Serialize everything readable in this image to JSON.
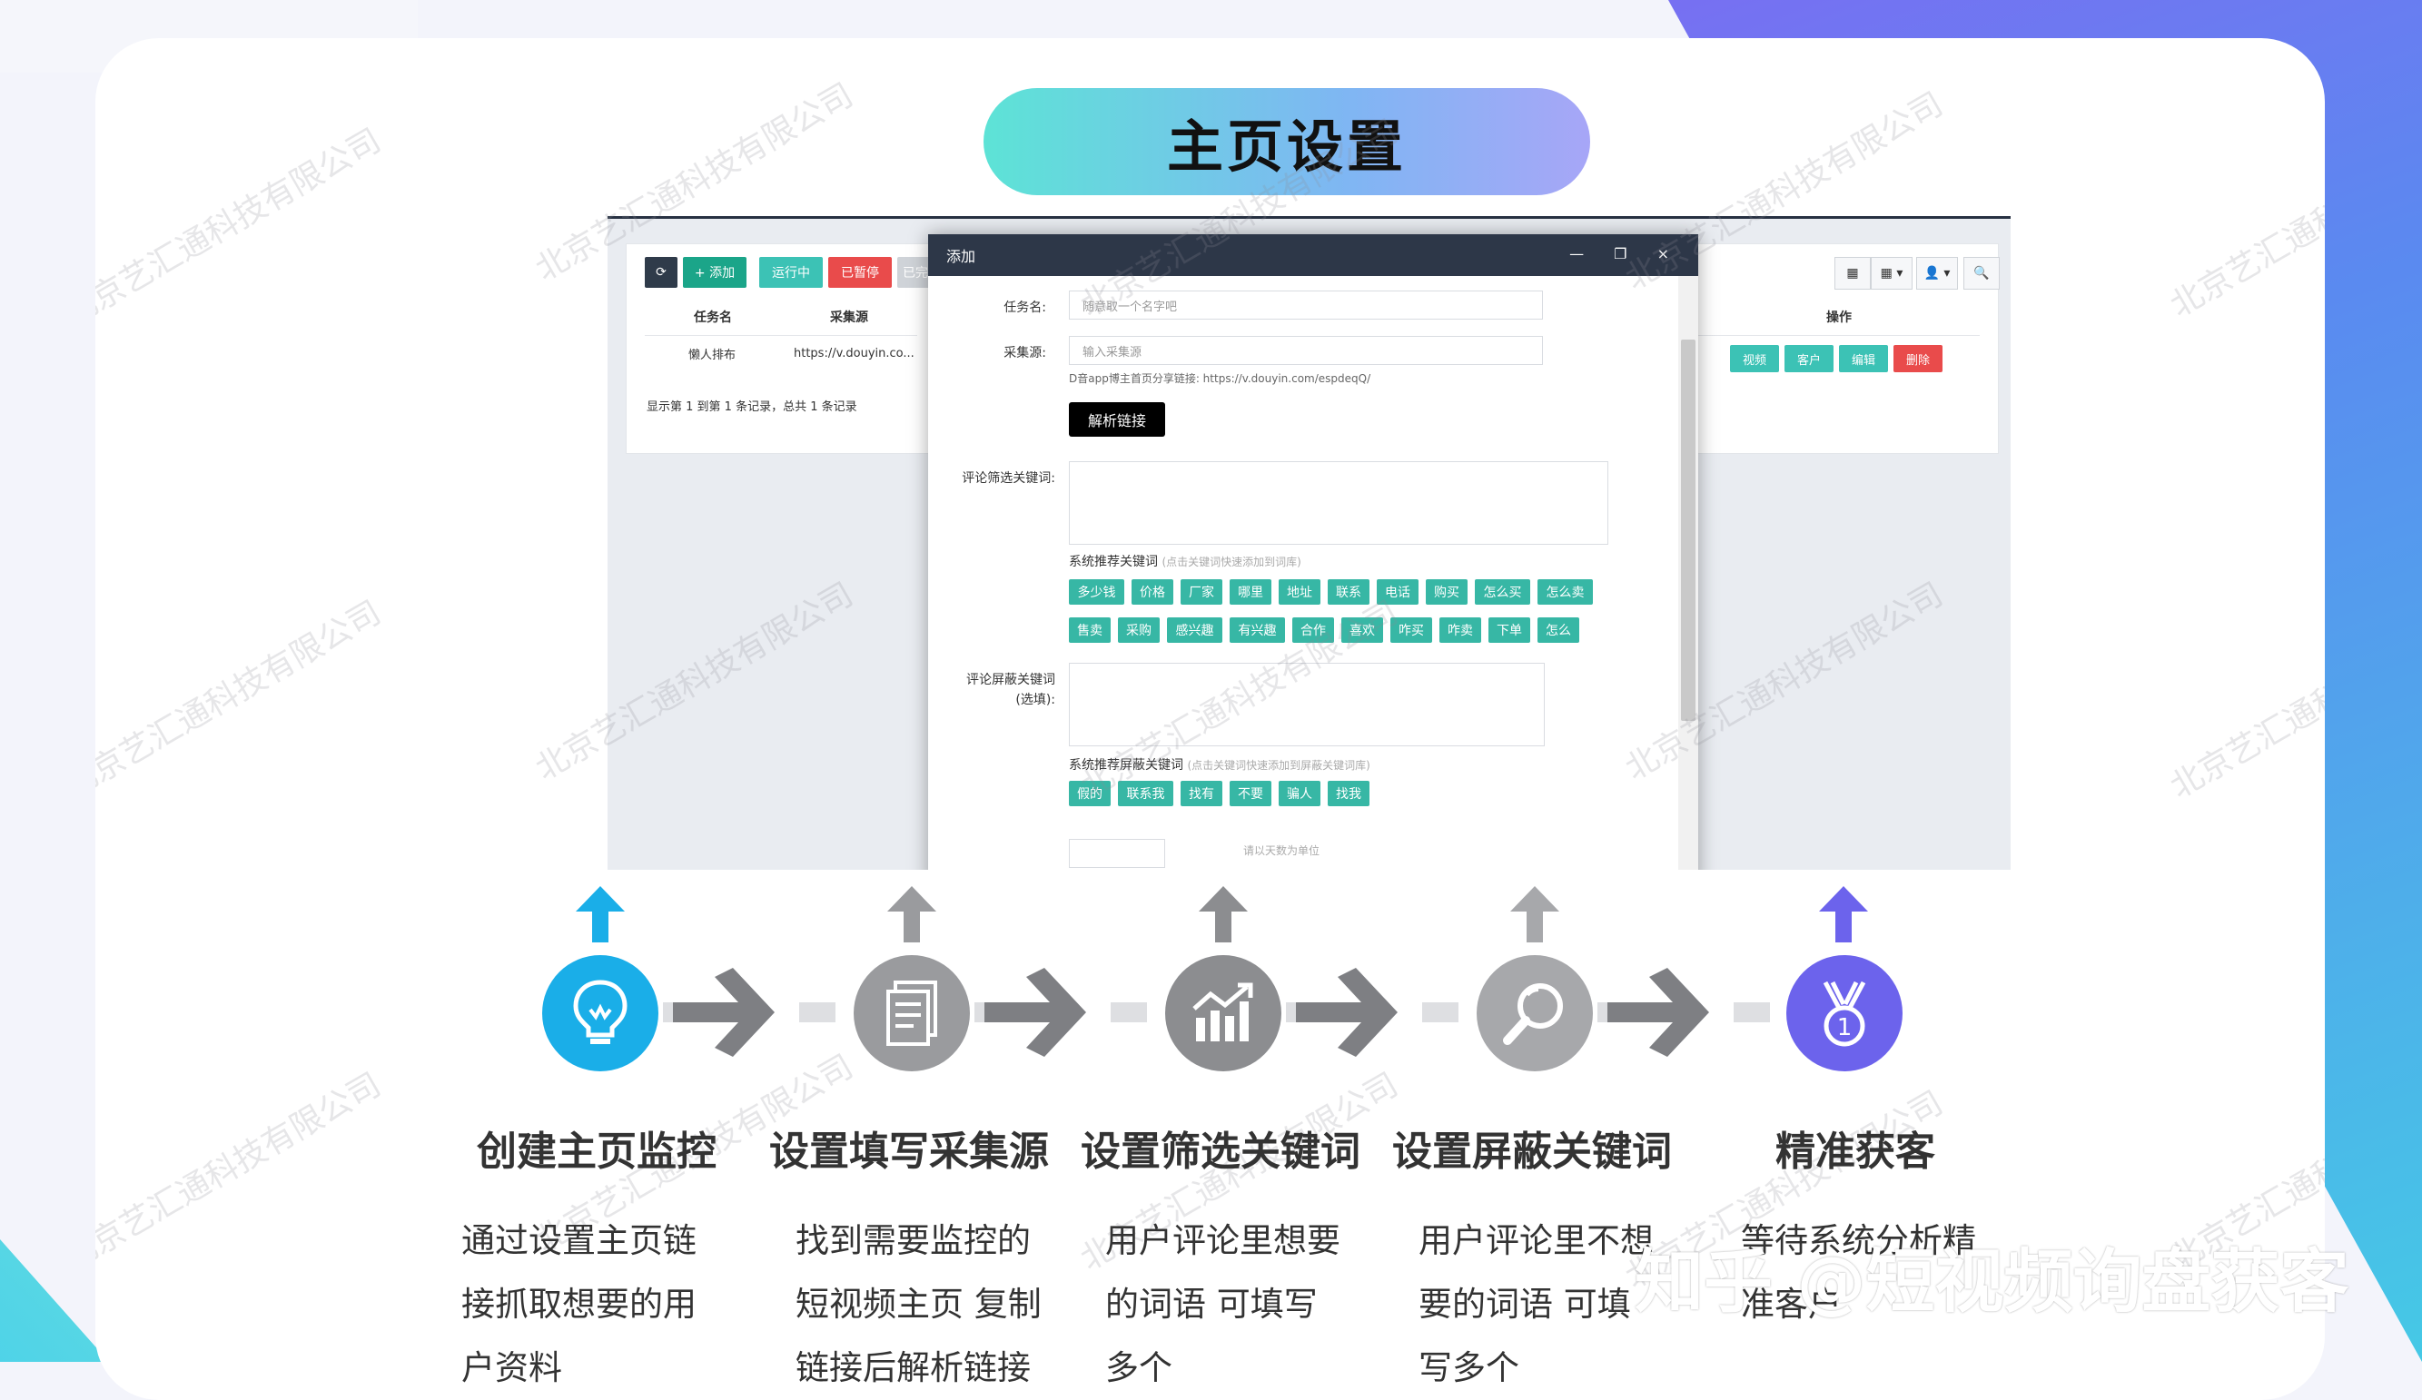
{
  "page_title": "主页设置",
  "list": {
    "toolbar": {
      "refresh": "⟳",
      "add": "+ 添加",
      "running": "运行中",
      "paused": "已暂停",
      "done": "已完",
      "icons": [
        "▦",
        "▦ ▾",
        "👤 ▾",
        "🔍"
      ]
    },
    "columns": [
      "任务名",
      "采集源",
      "操作"
    ],
    "rows": [
      {
        "task": "懒人排布",
        "source": "https://v.douyin.co..."
      }
    ],
    "row_actions": [
      "视频",
      "客户",
      "编辑",
      "删除"
    ],
    "pager": "显示第 1 到第 1 条记录，总共 1 条记录"
  },
  "modal": {
    "title": "添加",
    "controls": "— ❐ ×",
    "task_label": "任务名:",
    "task_placeholder": "随意取一个名字吧",
    "source_label": "采集源:",
    "source_placeholder": "输入采集源",
    "source_hint": "D音app博主首页分享链接: https://v.douyin.com/espdeqQ/",
    "parse_button": "解析链接",
    "filter_label": "评论筛选关键词:",
    "filter_rec_label": "系统推荐关键词",
    "filter_rec_sub": "(点击关键词快速添加到词库)",
    "filter_tags": [
      "多少钱",
      "价格",
      "厂家",
      "哪里",
      "地址",
      "联系",
      "电话",
      "购买",
      "怎么买",
      "怎么卖",
      "售卖",
      "采购",
      "感兴趣",
      "有兴趣",
      "合作",
      "喜欢",
      "咋买",
      "咋卖",
      "下单",
      "怎么"
    ],
    "block_label": "评论屏蔽关键词",
    "block_label_sub": "(选填):",
    "block_rec_label": "系统推荐屏蔽关键词",
    "block_rec_sub": "(点击关键词快速添加到屏蔽关键词库)",
    "block_tags": [
      "假的",
      "联系我",
      "找有",
      "不要",
      "骗人",
      "找我"
    ],
    "extra_hint": "请以天数为单位"
  },
  "watermark": "北京艺汇通科技有限公司",
  "steps": [
    {
      "title": "创建主页监控",
      "desc": [
        "通过设置主页链",
        "接抓取想要的用",
        "户资料"
      ],
      "icon": "lightbulb-icon",
      "color": "#1aaee8"
    },
    {
      "title": "设置填写采集源",
      "desc": [
        "找到需要监控的",
        "短视频主页 复制",
        "链接后解析链接"
      ],
      "icon": "document-icon",
      "color": "#9a9b9e"
    },
    {
      "title": "设置筛选关键词",
      "desc": [
        "用户评论里想要",
        "的词语 可填写",
        "多个"
      ],
      "icon": "chart-icon",
      "color": "#8c8d90"
    },
    {
      "title": "设置屏蔽关键词",
      "desc": [
        "用户评论里不想",
        "要的词语 可填",
        "写多个"
      ],
      "icon": "magnifier-icon",
      "color": "#a7a8ab"
    },
    {
      "title": "精准获客",
      "desc": [
        "等待系统分析精",
        "准客户"
      ],
      "icon": "medal-icon",
      "color": "#6c63ec"
    }
  ],
  "credit": "知乎 @短视频询盘获客",
  "colors": {
    "accent_teal": "#37b7a5",
    "accent_blue": "#1aaee8",
    "arrow_gray": "#7e7f83"
  }
}
